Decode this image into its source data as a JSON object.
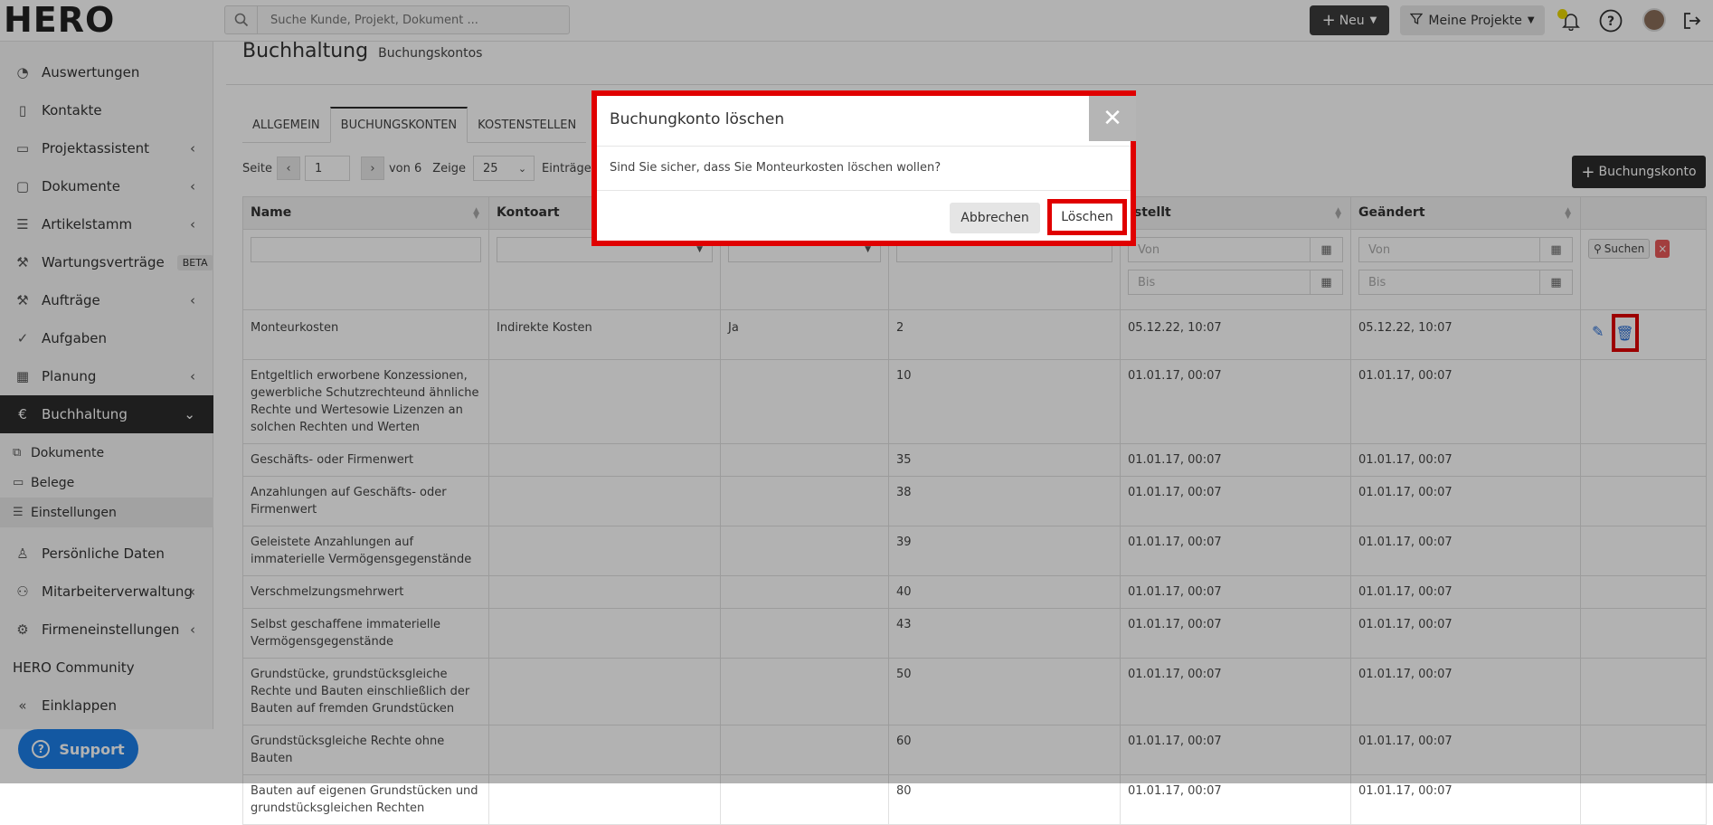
{
  "header": {
    "logo_text": "HERO",
    "search_placeholder": "Suche Kunde, Projekt, Dokument ...",
    "new_label": "Neu",
    "projects_label": "Meine Projekte"
  },
  "sidebar": {
    "items": [
      {
        "label": "Auswertungen"
      },
      {
        "label": "Kontakte"
      },
      {
        "label": "Projektassistent"
      },
      {
        "label": "Dokumente"
      },
      {
        "label": "Artikelstamm"
      },
      {
        "label": "Wartungsverträge",
        "badge": "BETA"
      },
      {
        "label": "Aufträge"
      },
      {
        "label": "Aufgaben"
      },
      {
        "label": "Planung"
      },
      {
        "label": "Buchhaltung"
      }
    ],
    "sub_items": [
      {
        "label": "Dokumente"
      },
      {
        "label": "Belege"
      },
      {
        "label": "Einstellungen"
      }
    ],
    "bottom_items": [
      {
        "label": "Persönliche Daten"
      },
      {
        "label": "Mitarbeiterverwaltung"
      },
      {
        "label": "Firmeneinstellungen"
      },
      {
        "label": "HERO Community"
      },
      {
        "label": "Einklappen"
      }
    ],
    "support_label": "Support"
  },
  "page": {
    "title": "Buchhaltung",
    "subtitle": "Buchungskontos",
    "tabs": [
      {
        "label": "ALLGEMEIN"
      },
      {
        "label": "BUCHUNGSKONTEN"
      },
      {
        "label": "KOSTENSTELLEN"
      }
    ],
    "pager": {
      "page_label": "Seite",
      "page_value": "1",
      "of_label": "von 6",
      "show_label": "Zeige",
      "per_page": "25",
      "entries_label": "Einträge"
    },
    "add_button": "Buchungskonto"
  },
  "table": {
    "columns": [
      {
        "label": "Name"
      },
      {
        "label": "Kontoart"
      },
      {
        "label": ""
      },
      {
        "label": ""
      },
      {
        "label": "rstellt"
      },
      {
        "label": "Geändert"
      },
      {
        "label": ""
      }
    ],
    "filters": {
      "from_placeholder": "Von",
      "to_placeholder": "Bis",
      "search_label": "Suchen"
    },
    "rows": [
      {
        "name": "Monteurkosten",
        "kontoart": "Indirekte Kosten",
        "col3": "Ja",
        "nummer": "2",
        "erstellt": "05.12.22, 10:07",
        "geaendert": "05.12.22, 10:07"
      },
      {
        "name": "Entgeltlich erworbene Konzessionen, gewerbliche Schutzrechteund ähnliche Rechte und Wertesowie Lizenzen an solchen Rechten und Werten",
        "kontoart": "",
        "col3": "",
        "nummer": "10",
        "erstellt": "01.01.17, 00:07",
        "geaendert": "01.01.17, 00:07"
      },
      {
        "name": "Geschäfts- oder Firmenwert",
        "kontoart": "",
        "col3": "",
        "nummer": "35",
        "erstellt": "01.01.17, 00:07",
        "geaendert": "01.01.17, 00:07"
      },
      {
        "name": "Anzahlungen auf Geschäfts- oder Firmenwert",
        "kontoart": "",
        "col3": "",
        "nummer": "38",
        "erstellt": "01.01.17, 00:07",
        "geaendert": "01.01.17, 00:07"
      },
      {
        "name": "Geleistete Anzahlungen auf immaterielle Vermögensgegenstände",
        "kontoart": "",
        "col3": "",
        "nummer": "39",
        "erstellt": "01.01.17, 00:07",
        "geaendert": "01.01.17, 00:07"
      },
      {
        "name": "Verschmelzungsmehrwert",
        "kontoart": "",
        "col3": "",
        "nummer": "40",
        "erstellt": "01.01.17, 00:07",
        "geaendert": "01.01.17, 00:07"
      },
      {
        "name": "Selbst geschaffene immaterielle Vermögensgegenstände",
        "kontoart": "",
        "col3": "",
        "nummer": "43",
        "erstellt": "01.01.17, 00:07",
        "geaendert": "01.01.17, 00:07"
      },
      {
        "name": "Grundstücke, grundstücksgleiche Rechte und Bauten einschließlich der Bauten auf fremden Grundstücken",
        "kontoart": "",
        "col3": "",
        "nummer": "50",
        "erstellt": "01.01.17, 00:07",
        "geaendert": "01.01.17, 00:07"
      },
      {
        "name": "Grundstücksgleiche Rechte ohne Bauten",
        "kontoart": "",
        "col3": "",
        "nummer": "60",
        "erstellt": "01.01.17, 00:07",
        "geaendert": "01.01.17, 00:07"
      },
      {
        "name": "Bauten auf eigenen Grundstücken und grundstücksgleichen Rechten",
        "kontoart": "",
        "col3": "",
        "nummer": "80",
        "erstellt": "01.01.17, 00:07",
        "geaendert": "01.01.17, 00:07"
      }
    ]
  },
  "modal": {
    "title": "Buchungkonto löschen",
    "message": "Sind Sie sicher, dass Sie Monteurkosten löschen wollen?",
    "cancel_label": "Abbrechen",
    "delete_label": "Löschen",
    "close_icon": "close-icon",
    "highlight_color": "#e00000"
  },
  "colors": {
    "dark": "#2b2b2b",
    "support_blue": "#1c7fe8",
    "link_blue": "#2a6fd6",
    "danger": "#e85a5a"
  }
}
